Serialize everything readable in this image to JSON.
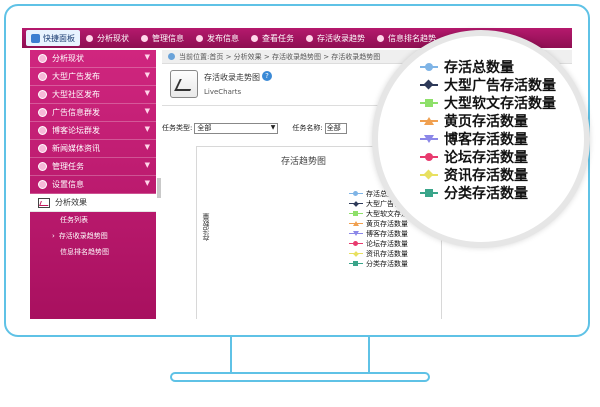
{
  "topbar": {
    "home_label": "快捷面板",
    "items": [
      "分析现状",
      "管理信息",
      "发布信息",
      "查看任务",
      "存活收录趋势",
      "信息排名趋势"
    ]
  },
  "sidebar": {
    "items": [
      {
        "label": "分析现状"
      },
      {
        "label": "大型广告发布"
      },
      {
        "label": "大型社区发布"
      },
      {
        "label": "广告信息群发"
      },
      {
        "label": "博客论坛群发"
      },
      {
        "label": "新闻媒体资讯"
      },
      {
        "label": "管理任务"
      },
      {
        "label": "设置信息"
      }
    ],
    "active_section": "分析效果",
    "subitems": [
      "任务列表",
      "存活收录趋势图",
      "信息排名趋势图"
    ]
  },
  "breadcrumb": "当前位置:首页 > 分析效果 > 存活收录趋势图 > 存活收录趋势图",
  "header": {
    "title": "存活收录走势图",
    "subtitle": "LiveCharts"
  },
  "filters": {
    "type_label": "任务类型:",
    "type_value": "全部",
    "name_label": "任务名称:",
    "name_value": "全部"
  },
  "chart": {
    "title": "存活趋势图",
    "ylabel": "存活数量"
  },
  "legend": [
    {
      "name": "存活总数量",
      "color": "#7fb4e6",
      "shape": "circle"
    },
    {
      "name": "大型广告存活数量",
      "color": "#2e3a59",
      "shape": "diamond"
    },
    {
      "name": "大型软文存活数量",
      "color": "#8ee06a",
      "shape": "square"
    },
    {
      "name": "黄页存活数量",
      "color": "#f0a050",
      "shape": "tri-up"
    },
    {
      "name": "博客存活数量",
      "color": "#8b87e8",
      "shape": "tri"
    },
    {
      "name": "论坛存活数量",
      "color": "#e83a6e",
      "shape": "circle"
    },
    {
      "name": "资讯存活数量",
      "color": "#e8e060",
      "shape": "diamond"
    },
    {
      "name": "分类存活数量",
      "color": "#3aa58a",
      "shape": "square"
    }
  ],
  "colors": {
    "sidebar": "#c01a72",
    "topbar": "#9e1160",
    "monitor_outline": "#5fc2e6"
  }
}
